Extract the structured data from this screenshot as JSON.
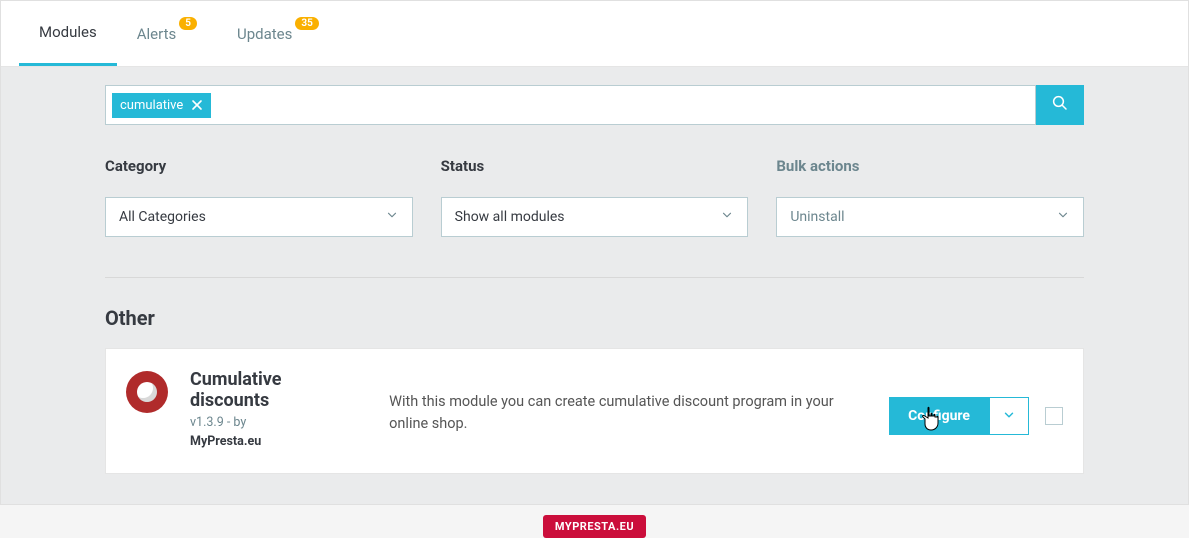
{
  "tabs": {
    "modules": "Modules",
    "alerts": "Alerts",
    "alerts_badge": "5",
    "updates": "Updates",
    "updates_badge": "35"
  },
  "search": {
    "chip": "cumulative"
  },
  "filters": {
    "category_label": "Category",
    "category_value": "All Categories",
    "status_label": "Status",
    "status_value": "Show all modules",
    "bulk_label": "Bulk actions",
    "bulk_value": "Uninstall"
  },
  "section": {
    "title": "Other"
  },
  "module": {
    "title": "Cumulative discounts",
    "version_prefix": "v1.3.9 - by",
    "author": "MyPresta.eu",
    "description": "With this module you can create cumulative discount program in your online shop.",
    "configure": "Configure"
  },
  "footer": {
    "badge": "MYPRESTA.EU"
  }
}
